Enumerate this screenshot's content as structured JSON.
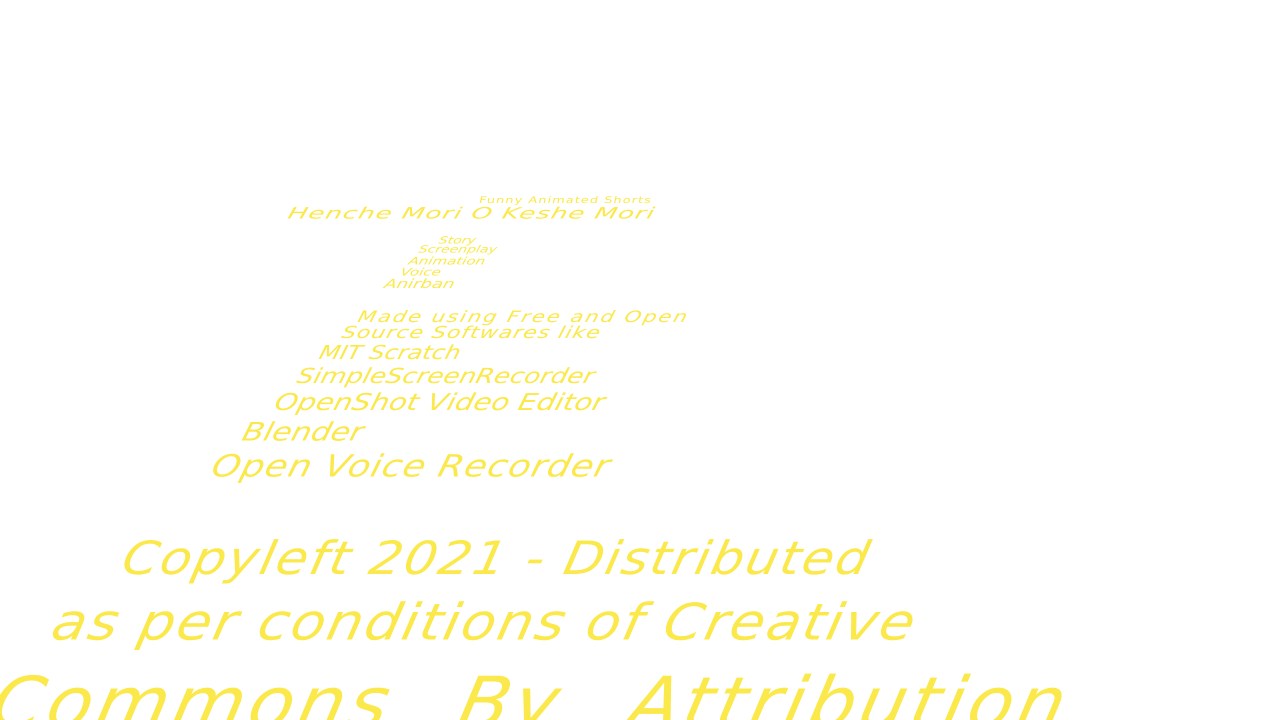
{
  "colors": {
    "background": "#ffffff",
    "text": "#fbe84a"
  },
  "credits": {
    "series_label": "Funny Animated Shorts",
    "title": "Henche Mori O Keshe Mori",
    "roles": [
      "Story",
      "Screenplay",
      "Animation",
      "Voice",
      "Anirban"
    ],
    "made_with": [
      "Made using Free and Open",
      "Source Softwares like"
    ],
    "software": [
      "MIT Scratch",
      "SimpleScreenRecorder",
      "OpenShot Video Editor",
      "Blender",
      "Open Voice Recorder"
    ],
    "license": [
      "Copyleft 2021 - Distributed",
      "as per conditions of Creative",
      "Commons By Attribution"
    ]
  }
}
